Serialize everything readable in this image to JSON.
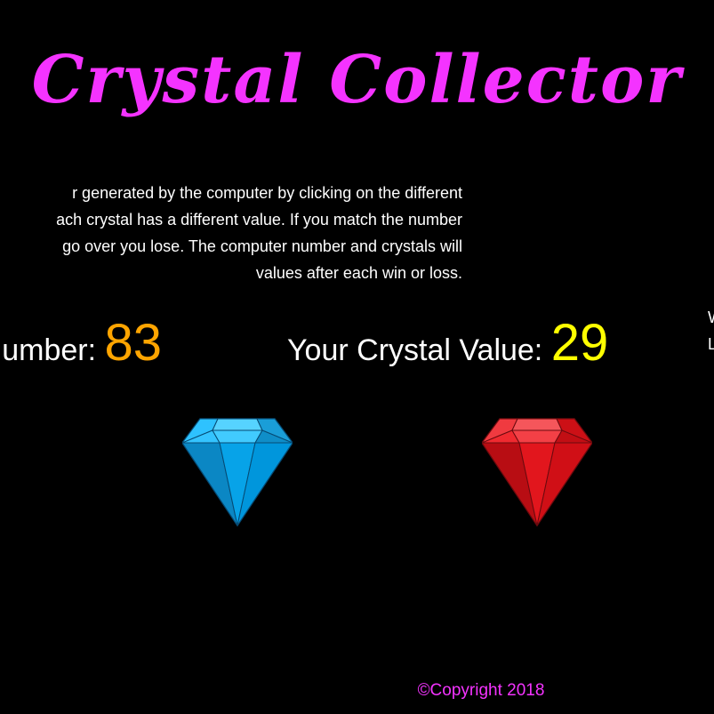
{
  "title": "Crystal Collector",
  "instructions": [
    "r generated by the computer by clicking on the different",
    "ach crystal has a different value. If you match the number",
    " go over you lose. The computer number and crystals will",
    "values after each win or loss."
  ],
  "target": {
    "label": "umber: ",
    "value": "83",
    "value_color": "#ffa500"
  },
  "current": {
    "label": "Your Crystal Value: ",
    "value": "29",
    "value_color": "#ffff00"
  },
  "stats": {
    "wins_label": "W",
    "losses_label": "L"
  },
  "crystals": [
    {
      "icon": "blue-gem-icon",
      "color": "#00a9f4"
    },
    {
      "icon": "red-gem-icon",
      "color": "#e8141c"
    }
  ],
  "footer": "©Copyright 2018",
  "colors": {
    "background": "#000000",
    "accent": "#f433ff",
    "text": "#ffffff"
  }
}
